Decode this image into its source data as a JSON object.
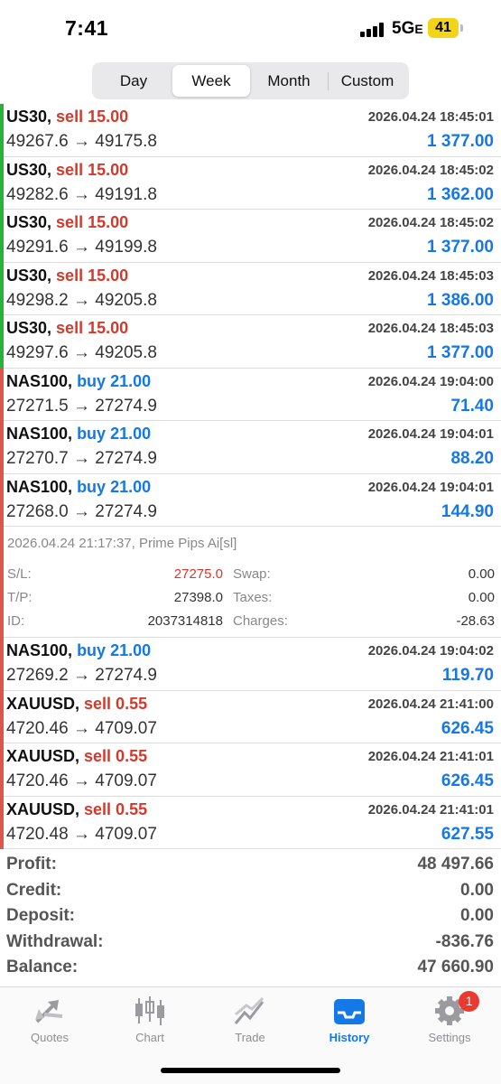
{
  "status": {
    "time": "7:41",
    "network": "5G",
    "network_suffix": "E",
    "battery": "41"
  },
  "period_tabs": [
    {
      "label": "Day",
      "active": false
    },
    {
      "label": "Week",
      "active": true
    },
    {
      "label": "Month",
      "active": false
    },
    {
      "label": "Custom",
      "active": false
    }
  ],
  "colors": {
    "sell": "#d23a2c",
    "buy": "#1479e6",
    "accent_green": "#27b33a",
    "accent_red": "#e0544a",
    "active_tab": "#1479e6"
  },
  "trades": [
    {
      "symbol": "US30,",
      "side": "sell",
      "side_label": "sell 15.00",
      "time": "2026.04.24 18:45:01",
      "open": "49267.6",
      "close": "49175.8",
      "profit": "1 377.00",
      "accent": "green"
    },
    {
      "symbol": "US30,",
      "side": "sell",
      "side_label": "sell 15.00",
      "time": "2026.04.24 18:45:02",
      "open": "49282.6",
      "close": "49191.8",
      "profit": "1 362.00",
      "accent": "green"
    },
    {
      "symbol": "US30,",
      "side": "sell",
      "side_label": "sell 15.00",
      "time": "2026.04.24 18:45:02",
      "open": "49291.6",
      "close": "49199.8",
      "profit": "1 377.00",
      "accent": "green"
    },
    {
      "symbol": "US30,",
      "side": "sell",
      "side_label": "sell 15.00",
      "time": "2026.04.24 18:45:03",
      "open": "49298.2",
      "close": "49205.8",
      "profit": "1 386.00",
      "accent": "green"
    },
    {
      "symbol": "US30,",
      "side": "sell",
      "side_label": "sell 15.00",
      "time": "2026.04.24 18:45:03",
      "open": "49297.6",
      "close": "49205.8",
      "profit": "1 377.00",
      "accent": "green"
    },
    {
      "symbol": "NAS100,",
      "side": "buy",
      "side_label": "buy 21.00",
      "time": "2026.04.24 19:04:00",
      "open": "27271.5",
      "close": "27274.9",
      "profit": "71.40",
      "accent": "red"
    },
    {
      "symbol": "NAS100,",
      "side": "buy",
      "side_label": "buy 21.00",
      "time": "2026.04.24 19:04:01",
      "open": "27270.7",
      "close": "27274.9",
      "profit": "88.20",
      "accent": "red"
    },
    {
      "symbol": "NAS100,",
      "side": "buy",
      "side_label": "buy 21.00",
      "time": "2026.04.24 19:04:01",
      "open": "27268.0",
      "close": "27274.9",
      "profit": "144.90",
      "accent": "red"
    }
  ],
  "expanded_details": {
    "comment": "2026.04.24 21:17:37, Prime Pips Ai[sl]",
    "sl_label": "S/L:",
    "sl_value": "27275.0",
    "tp_label": "T/P:",
    "tp_value": "27398.0",
    "id_label": "ID:",
    "id_value": "2037314818",
    "swap_label": "Swap:",
    "swap_value": "0.00",
    "taxes_label": "Taxes:",
    "taxes_value": "0.00",
    "charges_label": "Charges:",
    "charges_value": "-28.63"
  },
  "trades_after": [
    {
      "symbol": "NAS100,",
      "side": "buy",
      "side_label": "buy 21.00",
      "time": "2026.04.24 19:04:02",
      "open": "27269.2",
      "close": "27274.9",
      "profit": "119.70",
      "accent": "red"
    },
    {
      "symbol": "XAUUSD,",
      "side": "sell",
      "side_label": "sell 0.55",
      "time": "2026.04.24 21:41:00",
      "open": "4720.46",
      "close": "4709.07",
      "profit": "626.45",
      "accent": "red"
    },
    {
      "symbol": "XAUUSD,",
      "side": "sell",
      "side_label": "sell 0.55",
      "time": "2026.04.24 21:41:01",
      "open": "4720.46",
      "close": "4709.07",
      "profit": "626.45",
      "accent": "red"
    },
    {
      "symbol": "XAUUSD,",
      "side": "sell",
      "side_label": "sell 0.55",
      "time": "2026.04.24 21:41:01",
      "open": "4720.48",
      "close": "4709.07",
      "profit": "627.55",
      "accent": "red"
    }
  ],
  "arrow": "→",
  "summary": [
    {
      "label": "Profit:",
      "value": "48 497.66"
    },
    {
      "label": "Credit:",
      "value": "0.00"
    },
    {
      "label": "Deposit:",
      "value": "0.00"
    },
    {
      "label": "Withdrawal:",
      "value": "-836.76"
    },
    {
      "label": "Balance:",
      "value": "47 660.90"
    }
  ],
  "tabbar": [
    {
      "label": "Quotes",
      "icon": "quotes-arrows-icon",
      "active": false
    },
    {
      "label": "Chart",
      "icon": "candlestick-icon",
      "active": false
    },
    {
      "label": "Trade",
      "icon": "trade-line-icon",
      "active": false
    },
    {
      "label": "History",
      "icon": "inbox-tray-icon",
      "active": true
    },
    {
      "label": "Settings",
      "icon": "gear-icon",
      "active": false,
      "badge": "1"
    }
  ]
}
